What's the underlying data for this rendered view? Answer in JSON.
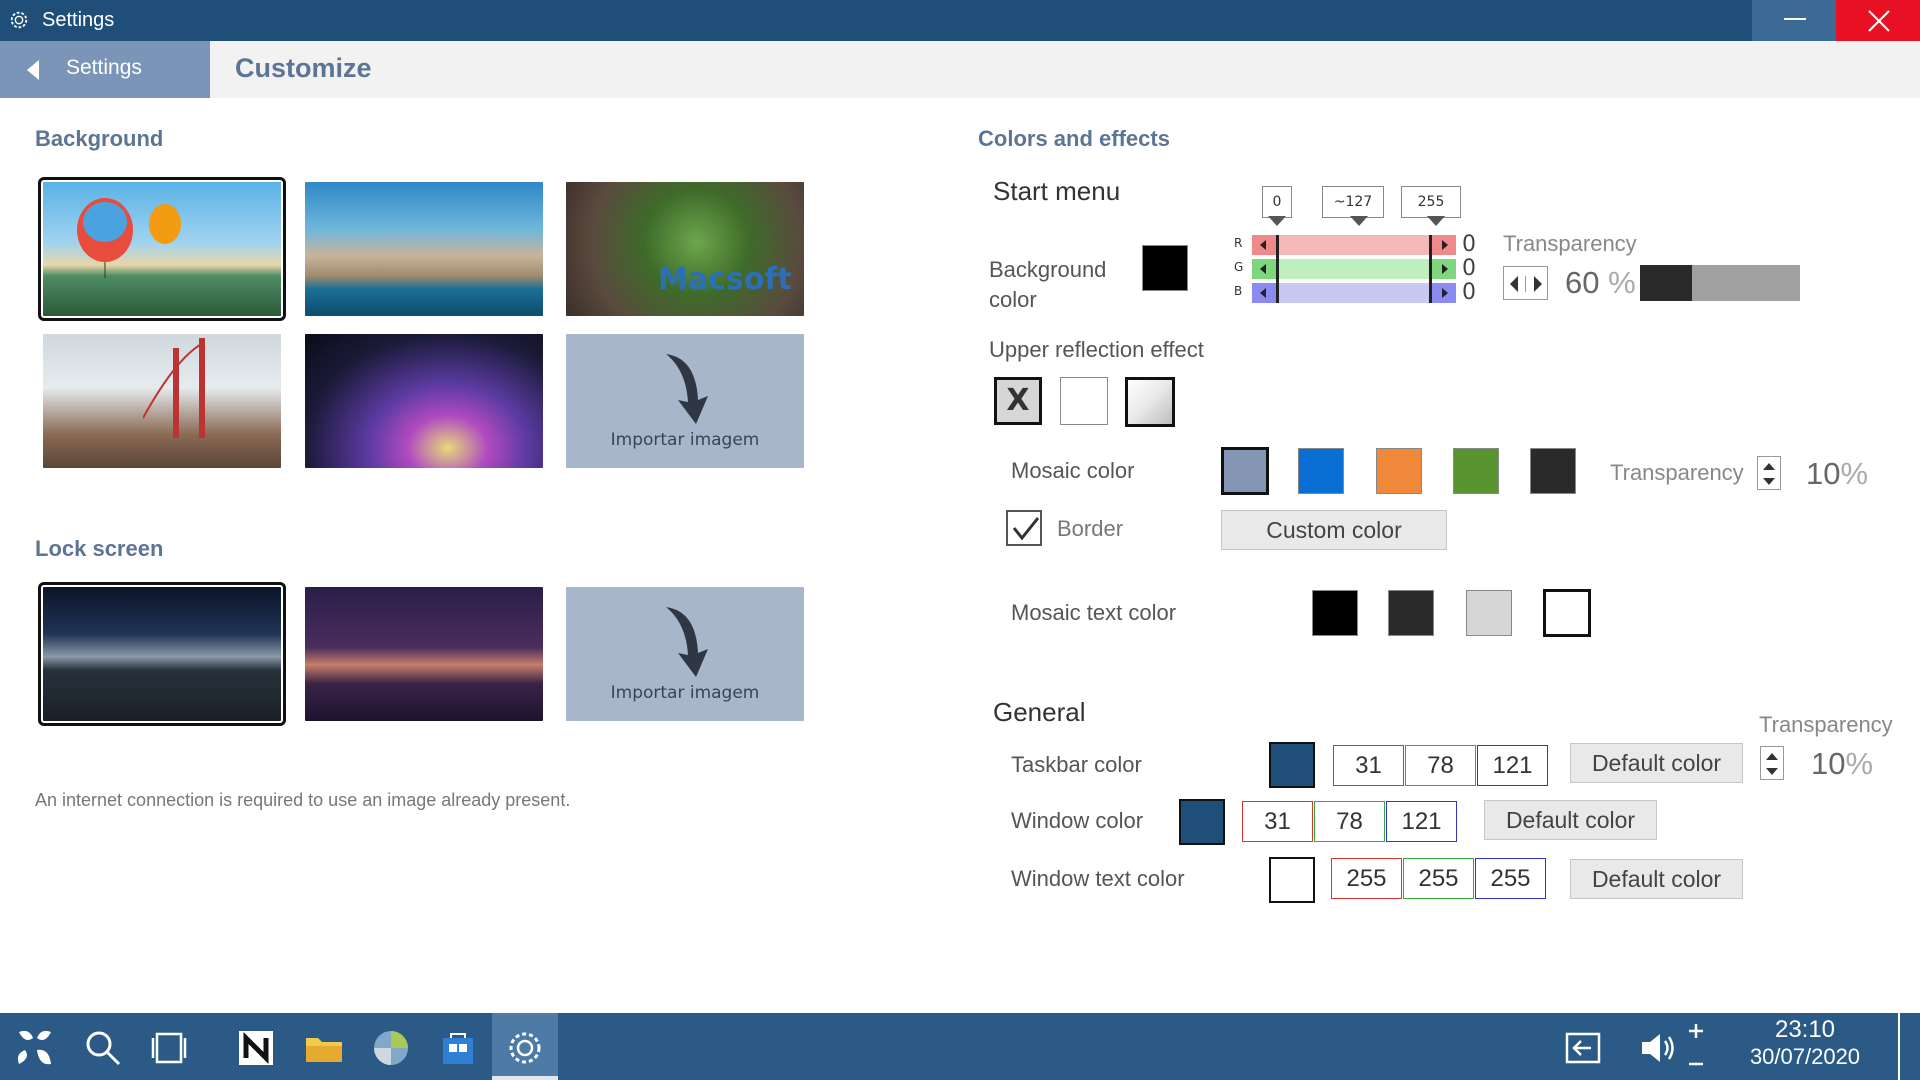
{
  "window": {
    "title": "Settings"
  },
  "nav": {
    "back_label": "Settings",
    "page_title": "Customize"
  },
  "background": {
    "title": "Background",
    "import_label": "Importar imagem",
    "watermark": "Macsoft"
  },
  "lock": {
    "title": "Lock screen",
    "import_label": "Importar imagem"
  },
  "note": "An internet connection is required to use an image already present.",
  "colors": {
    "title": "Colors and effects",
    "start": {
      "title": "Start menu",
      "bg_label_1": "Background",
      "bg_label_2": "color",
      "markers": [
        "0",
        "~127",
        "255"
      ],
      "channels": {
        "r": "R",
        "g": "G",
        "b": "B"
      },
      "values": {
        "r": "0",
        "g": "0",
        "b": "0"
      },
      "transparency_label": "Transparency",
      "transparency_value": "60",
      "transparency_fraction": 0.6,
      "percent": "%"
    },
    "reflection": {
      "title": "Upper reflection effect",
      "none_glyph": "X"
    },
    "mosaic": {
      "label": "Mosaic color",
      "swatches": [
        "#8496b4",
        "#0a6fd4",
        "#ef8a3c",
        "#5a9431",
        "#2a2a2a"
      ],
      "transparency_label": "Transparency",
      "transparency_value": "10",
      "percent": "%",
      "border_label": "Border",
      "custom_label": "Custom color",
      "text_label": "Mosaic text color",
      "text_swatches": [
        "#000000",
        "#2a2a2a",
        "#d6d6d6",
        "#ffffff"
      ]
    },
    "general": {
      "title": "General",
      "transparency_label": "Transparency",
      "transparency_value": "10",
      "percent": "%",
      "taskbar": {
        "label": "Taskbar color",
        "color": "#1f4e79",
        "r": "31",
        "g": "78",
        "b": "121",
        "default": "Default color"
      },
      "window": {
        "label": "Window color",
        "color": "#1f4e79",
        "r": "31",
        "g": "78",
        "b": "121",
        "default": "Default color"
      },
      "window_text": {
        "label": "Window text color",
        "color": "#ffffff",
        "r": "255",
        "g": "255",
        "b": "255",
        "default": "Default color"
      }
    }
  },
  "taskbar": {
    "time": "23:10",
    "date": "30/07/2020"
  }
}
